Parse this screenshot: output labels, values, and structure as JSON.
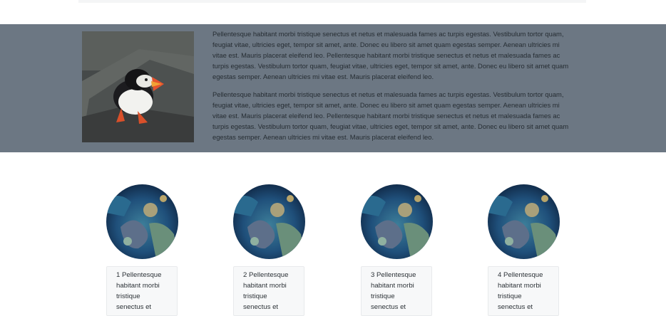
{
  "feature": {
    "image_alt": "puffin",
    "paragraphs": [
      "Pellentesque habitant morbi tristique senectus et netus et malesuada fames ac turpis egestas. Vestibulum tortor quam, feugiat vitae, ultricies eget, tempor sit amet, ante. Donec eu libero sit amet quam egestas semper. Aenean ultricies mi vitae est. Mauris placerat eleifend leo. Pellentesque habitant morbi tristique senectus et netus et malesuada fames ac turpis egestas. Vestibulum tortor quam, feugiat vitae, ultricies eget, tempor sit amet, ante. Donec eu libero sit amet quam egestas semper. Aenean ultricies mi vitae est. Mauris placerat eleifend leo.",
      "Pellentesque habitant morbi tristique senectus et netus et malesuada fames ac turpis egestas. Vestibulum tortor quam, feugiat vitae, ultricies eget, tempor sit amet, ante. Donec eu libero sit amet quam egestas semper. Aenean ultricies mi vitae est. Mauris placerat eleifend leo. Pellentesque habitant morbi tristique senectus et netus et malesuada fames ac turpis egestas. Vestibulum tortor quam, feugiat vitae, ultricies eget, tempor sit amet, ante. Donec eu libero sit amet quam egestas semper. Aenean ultricies mi vitae est. Mauris placerat eleifend leo."
    ]
  },
  "cards": [
    {
      "image": "reef-image",
      "caption": "1 Pellentesque habitant morbi tristique senectus et"
    },
    {
      "image": "reef-image",
      "caption": "2 Pellentesque habitant morbi tristique senectus et"
    },
    {
      "image": "reef-image",
      "caption": "3 Pellentesque habitant morbi tristique senectus et"
    },
    {
      "image": "reef-image",
      "caption": "4 Pellentesque habitant morbi tristique senectus et"
    }
  ],
  "colors": {
    "band": "#6c7783",
    "caption_bg": "#f7f8f9"
  }
}
